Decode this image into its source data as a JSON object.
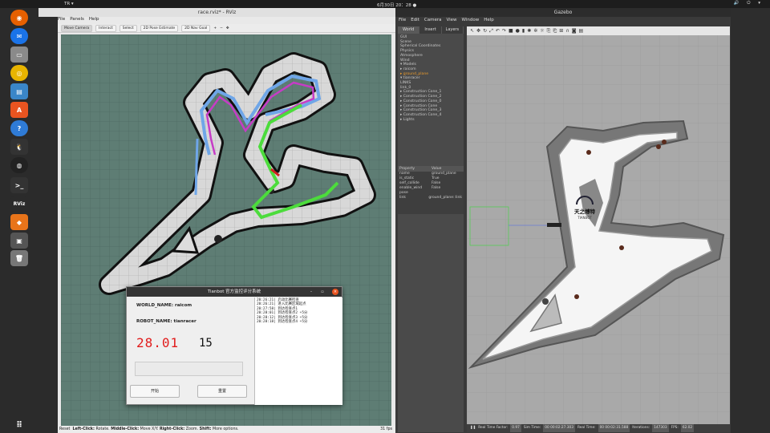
{
  "topbar": {
    "activities": "TR ▾",
    "clock": "6月30日 20：28 ●",
    "tray": "🔊 ⏻ ▾"
  },
  "dock": {
    "items": [
      "firefox-icon",
      "thunderbird-icon",
      "files-icon",
      "rhythmbox-icon",
      "libreoffice-icon",
      "software-icon",
      "help-icon",
      "obs-icon",
      "terminal-icon",
      "rviz-icon",
      "layers-icon",
      "app-icon",
      "trash-icon",
      "apps-grid-icon"
    ]
  },
  "rviz": {
    "window_title": "race.rviz* - RViz",
    "menu": [
      "File",
      "Panels",
      "Help"
    ],
    "toolbar": [
      "Move Camera",
      "Interact",
      "Select",
      "2D Pose Estimate",
      "2D Nav Goal",
      "+",
      "−",
      "✥"
    ],
    "status": {
      "reset": "Reset",
      "hint_left": "Left-Click:",
      "hint_left_v": " Rotate. ",
      "hint_mid": "Middle-Click:",
      "hint_mid_v": " Move X/Y. ",
      "hint_right": "Right-Click:",
      "hint_right_v": " Zoom. ",
      "hint_shift": "Shift:",
      "hint_shift_v": " More options.",
      "fps": "31 fps"
    }
  },
  "dialog": {
    "title": "Tianbot 官方监控评分系统",
    "world_name": "WORLD_NAME: raicom",
    "robot_name": "ROBOT_NAME: tianracer",
    "time_display": "28.01",
    "score_display": "15",
    "start_button": "开始",
    "reset_button": "重置",
    "log": [
      "20:26:21| 启动比赛检查",
      "20:26:21| 进入比赛区域起点",
      "20:27:58| 到达检查点1",
      "20:28:01| 到达检查点2 +5分",
      "20:28:12| 到达检查点3 +5分",
      "20:28:18| 到达检查点4 +5分"
    ]
  },
  "gazebo": {
    "window_title": "Gazebo",
    "menu": [
      "File",
      "Edit",
      "Camera",
      "View",
      "Window",
      "Help"
    ],
    "tabs": [
      "World",
      "Insert",
      "Layers"
    ],
    "tree": [
      "GUI",
      "Scene",
      "Spherical Coordinates",
      "Physics",
      "Atmosphere",
      "Wind",
      "▾ Models",
      "  ▸ raicom",
      "  ▸ ground_plane",
      "  ▾ tianracer",
      "      LINKS",
      "      link_0",
      "  ▸ Construction Cone_1",
      "  ▸ Construction Cone_2",
      "  ▸ Construction Cone_0",
      "  ▸ Construction Cone",
      "  ▸ Construction Cone_3",
      "  ▸ Construction Cone_4",
      "▸ Lights"
    ],
    "props_header": [
      "Property",
      "Value"
    ],
    "props": [
      [
        "name",
        "ground_plane"
      ],
      [
        "is_static",
        "True"
      ],
      [
        "self_collide",
        "False"
      ],
      [
        "enable_wind",
        "False"
      ],
      [
        "pose",
        ""
      ],
      [
        "link",
        "ground_plane::link"
      ]
    ],
    "bottom": {
      "real_time_factor_l": "Real Time Factor:",
      "real_time_factor": "0.97",
      "sim_time_l": "Sim Time:",
      "sim_time": "00 00:02:27.303",
      "real_time_l": "Real Time:",
      "real_time": "00 00:02:31.588",
      "iterations_l": "Iterations:",
      "iterations": "147303",
      "fps_l": "FPS:",
      "fps": "62.02"
    },
    "logo_text": "天之博特",
    "logo_sub": "TIANBOT"
  }
}
